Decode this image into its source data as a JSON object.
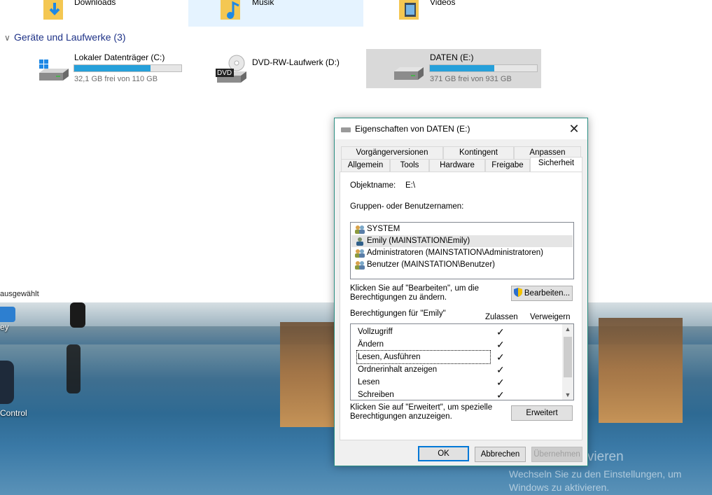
{
  "explorer": {
    "quick_access": [
      {
        "label": "Downloads",
        "icon": "downloads-folder-icon"
      },
      {
        "label": "Musik",
        "icon": "music-folder-icon"
      },
      {
        "label": "Videos",
        "icon": "videos-folder-icon"
      }
    ],
    "section_title": "Geräte und Laufwerke (3)",
    "drives": [
      {
        "name": "Lokaler Datenträger (C:)",
        "free": "32,1 GB frei von 110 GB",
        "used_fraction": 0.71
      },
      {
        "name": "DVD-RW-Laufwerk (D:)",
        "badge": "DVD"
      },
      {
        "name": "DATEN (E:)",
        "free": "371 GB frei von 931 GB",
        "used_fraction": 0.6
      }
    ],
    "status_text": "ausgewählt"
  },
  "desktop": {
    "icon_labels": [
      "ey",
      "Control"
    ],
    "activation_title": "Windows aktivieren",
    "activation_text": "Wechseln Sie zu den Einstellungen, um Windows zu aktivieren."
  },
  "dialog": {
    "title": "Eigenschaften von DATEN (E:)",
    "tabs_back": [
      "Vorgängerversionen",
      "Kontingent",
      "Anpassen"
    ],
    "tabs_front": [
      "Allgemein",
      "Tools",
      "Hardware",
      "Freigabe",
      "Sicherheit"
    ],
    "active_tab": "Sicherheit",
    "object_label": "Objektname:",
    "object_value": "E:\\",
    "groups_label": "Gruppen- oder Benutzernamen:",
    "users": [
      "SYSTEM",
      "Emily (MAINSTATION\\Emily)",
      "Administratoren (MAINSTATION\\Administratoren)",
      "Benutzer (MAINSTATION\\Benutzer)"
    ],
    "selected_user_index": 1,
    "edit_hint": "Klicken Sie auf \"Bearbeiten\", um die Berechtigungen zu ändern.",
    "edit_button": "Bearbeiten...",
    "perms_for": "Berechtigungen für \"Emily\"",
    "col_allow": "Zulassen",
    "col_deny": "Verweigern",
    "permissions": [
      {
        "name": "Vollzugriff",
        "allow": true
      },
      {
        "name": "Ändern",
        "allow": true
      },
      {
        "name": "Lesen, Ausführen",
        "allow": true
      },
      {
        "name": "Ordnerinhalt anzeigen",
        "allow": true
      },
      {
        "name": "Lesen",
        "allow": true
      },
      {
        "name": "Schreiben",
        "allow": true
      }
    ],
    "advanced_hint": "Klicken Sie auf \"Erweitert\", um spezielle Berechtigungen anzuzeigen.",
    "advanced_button": "Erweitert",
    "ok_button": "OK",
    "cancel_button": "Abbrechen",
    "apply_button": "Übernehmen",
    "check_glyph": "✓"
  }
}
